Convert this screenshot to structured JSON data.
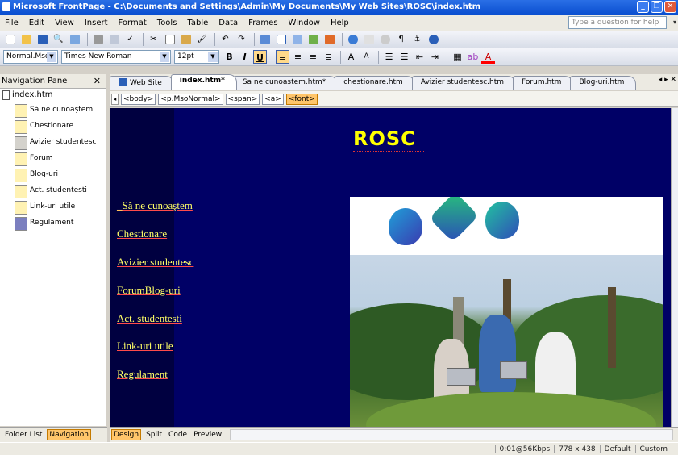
{
  "window": {
    "title": "Microsoft FrontPage - C:\\Documents and Settings\\Admin\\My Documents\\My Web Sites\\ROSC\\index.htm"
  },
  "menubar": {
    "items": [
      "File",
      "Edit",
      "View",
      "Insert",
      "Format",
      "Tools",
      "Table",
      "Data",
      "Frames",
      "Window",
      "Help"
    ],
    "ask_placeholder": "Type a question for help"
  },
  "format_toolbar": {
    "style": "Normal.Mso",
    "font": "Times New Roman",
    "size": "12pt"
  },
  "nav_pane": {
    "title": "Navigation Pane",
    "root": "index.htm",
    "items": [
      "Să ne cunoaştem",
      "Chestionare",
      "Avizier studentesc",
      "Forum",
      "Blog-uri",
      "Act. studentesti",
      "Link-uri utile",
      "Regulament"
    ],
    "tabs": [
      "Folder List",
      "Navigation"
    ]
  },
  "doc_tabs": [
    "Web Site",
    "index.htm*",
    "Sa ne cunoastem.htm*",
    "chestionare.htm",
    "Avizier studentesc.htm",
    "Forum.htm",
    "Blog-uri.htm"
  ],
  "quick_tags": [
    "<body>",
    "<p.MsoNormal>",
    "<span>",
    "<a>",
    "<font>"
  ],
  "page": {
    "title": "ROSC",
    "links": [
      "_Să ne cunoaştem",
      "Chestionare",
      "Avizier studentesc",
      "ForumBlog-uri",
      "Act. studentesti",
      "Link-uri utile",
      "Regulament"
    ]
  },
  "view_tabs": [
    "Design",
    "Split",
    "Code",
    "Preview"
  ],
  "statusbar": {
    "speed": "0:01@56Kbps",
    "dims": "778 x 438",
    "mode1": "Default",
    "mode2": "Custom"
  },
  "colors": {
    "page_bg": "#000066",
    "title_yellow": "#ffff00",
    "link_yellow": "#ffff66",
    "xp_blue": "#0a4fd0",
    "highlight": "#ffc56a"
  }
}
